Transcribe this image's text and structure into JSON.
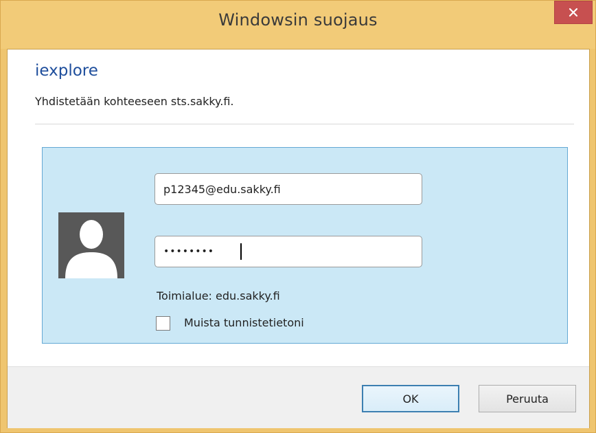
{
  "window": {
    "title": "Windowsin suojaus",
    "close_label": "×"
  },
  "header": {
    "app_name": "iexplore",
    "message": "Yhdistetään kohteeseen sts.sakky.fi."
  },
  "credentials": {
    "username_value": "p12345@edu.sakky.fi",
    "password_value": "••••••••",
    "domain_text": "Toimialue: edu.sakky.fi",
    "remember_label": "Muista tunnistetietoni",
    "remember_checked": false
  },
  "buttons": {
    "ok_label": "OK",
    "cancel_label": "Peruuta"
  },
  "icons": {
    "close": "close-icon",
    "user": "user-avatar-icon"
  },
  "colors": {
    "title_bar": "#f2cb78",
    "close_button": "#c75050",
    "app_name": "#1e4e9c",
    "panel": "#cbe8f6",
    "panel_border": "#63a8d4",
    "default_button_border": "#3c7fb1"
  }
}
